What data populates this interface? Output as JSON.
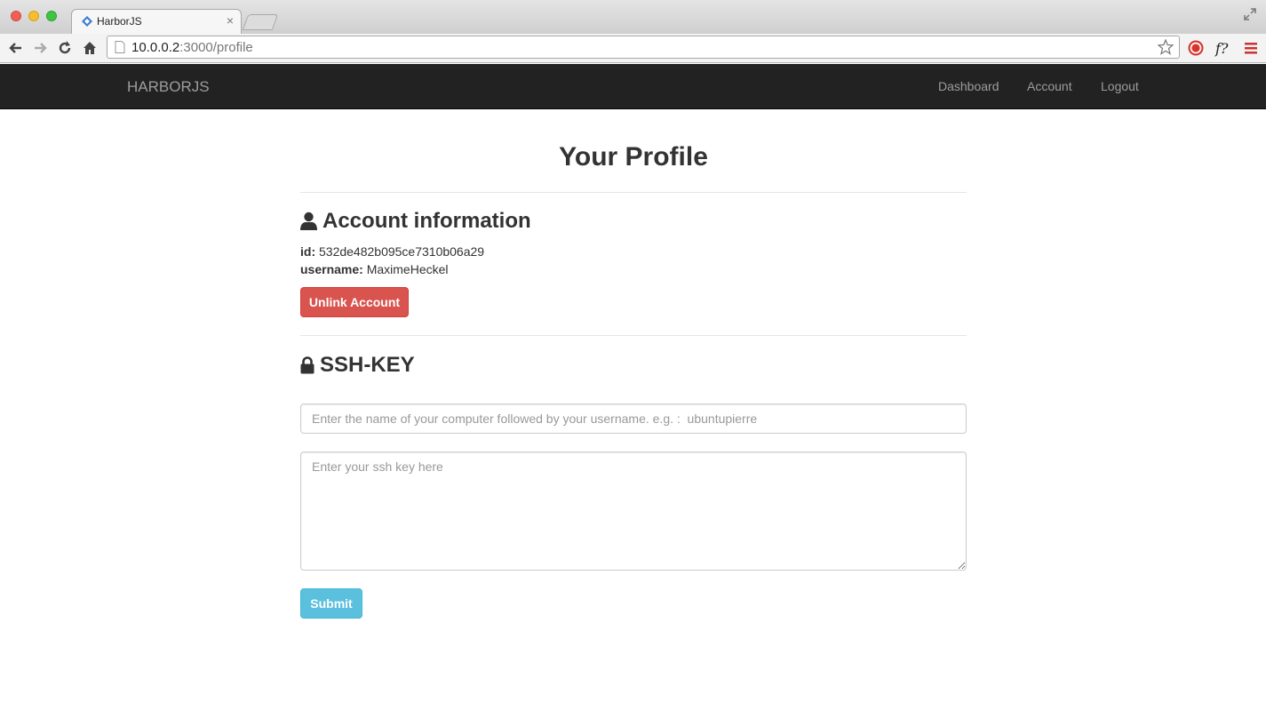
{
  "browser": {
    "tab_title": "HarborJS",
    "tab_close": "×",
    "url_host": "10.0.0.2",
    "url_rest": ":3000/profile"
  },
  "navbar": {
    "brand": "HARBORJS",
    "links": [
      "Dashboard",
      "Account",
      "Logout"
    ]
  },
  "page": {
    "title": "Your Profile"
  },
  "account": {
    "heading": "Account information",
    "id_label": "id:",
    "id_value": "532de482b095ce7310b06a29",
    "username_label": "username:",
    "username_value": "MaximeHeckel",
    "unlink_button": "Unlink Account"
  },
  "ssh": {
    "heading": "SSH-KEY",
    "name_placeholder": "Enter the name of your computer followed by your username. e.g. :  ubuntupierre",
    "key_placeholder": "Enter your ssh key here",
    "submit_button": "Submit"
  },
  "colors": {
    "navbar_bg": "#222222",
    "navbar_text": "#9d9d9d",
    "danger": "#d9534f",
    "info": "#5bc0de"
  }
}
